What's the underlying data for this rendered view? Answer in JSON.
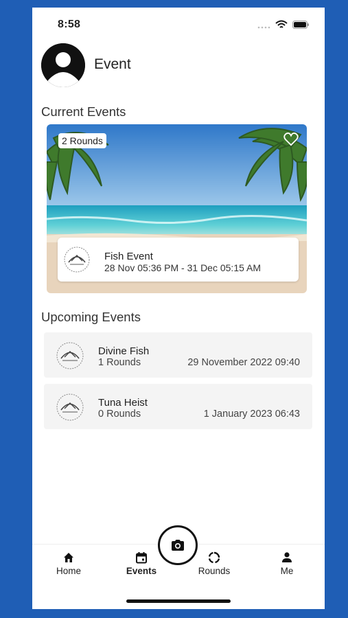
{
  "status_bar": {
    "time": "8:58"
  },
  "header": {
    "title": "Event",
    "avatar_icon": "user-avatar-icon"
  },
  "current_events": {
    "section_title": "Current Events",
    "card": {
      "rounds_badge": "2 Rounds",
      "name": "Fish Event",
      "dates": "28 Nov 05:36 PM - 31 Dec 05:15 AM",
      "favorite_icon": "heart-icon"
    }
  },
  "upcoming_events": {
    "section_title": "Upcoming Events",
    "items": [
      {
        "name": "Divine Fish",
        "rounds": "1 Rounds",
        "date": "29 November 2022 09:40"
      },
      {
        "name": "Tuna Heist",
        "rounds": "0 Rounds",
        "date": "1 January 2023 06:43"
      }
    ]
  },
  "tab_bar": {
    "tabs": [
      {
        "label": "Home",
        "icon": "home-icon"
      },
      {
        "label": "Events",
        "icon": "calendar-icon",
        "active": true
      },
      {
        "label": "Rounds",
        "icon": "rounds-icon"
      },
      {
        "label": "Me",
        "icon": "person-icon"
      }
    ],
    "camera_icon": "camera-icon"
  },
  "colors": {
    "background": "#1f5eb5",
    "surface": "#ffffff",
    "card": "#f4f4f4",
    "text": "#222222"
  }
}
